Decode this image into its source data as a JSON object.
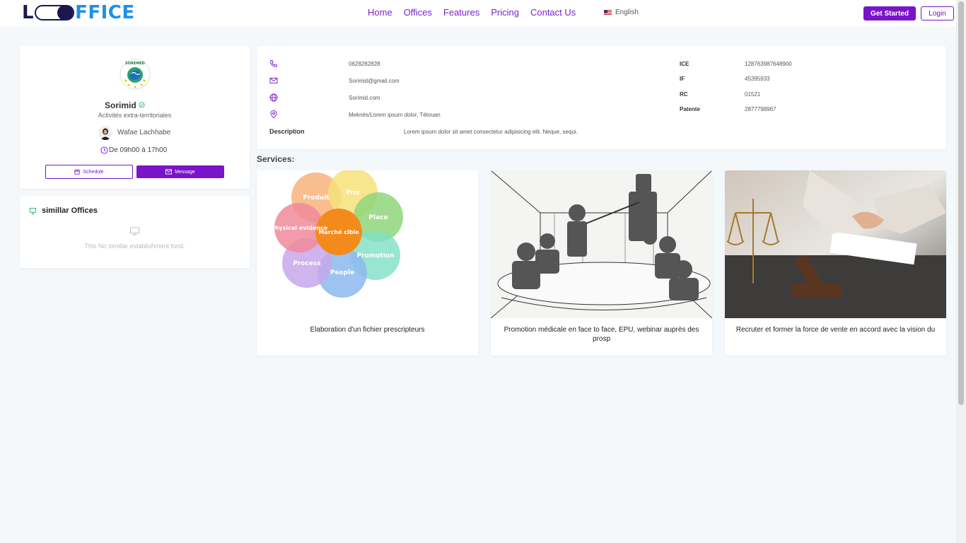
{
  "brand": {
    "logo_left": "L",
    "logo_right": "FFICE"
  },
  "nav": {
    "links": [
      "Home",
      "Offices",
      "Features",
      "Pricing",
      "Contact Us"
    ],
    "language": "English",
    "get_started": "Get Started",
    "login": "Login"
  },
  "profile": {
    "name": "Sorimid",
    "category": "Activités extra-territoriales",
    "owner": "Wafae Lachhabe",
    "hours": "De 09h00 à 17h00",
    "schedule_label": "Schedule",
    "message_label": "Message",
    "emblem_text": "SOREMED"
  },
  "similar": {
    "title": "simillar Offices",
    "empty_text": "This No simillar establishment fund."
  },
  "info": {
    "phone": "0628282828",
    "email": "Sorimid@gmail.com",
    "website": "Sorimid.com",
    "address": "Meknès/Lorem ipsum dolor, Tétouan",
    "ice_label": "ICE",
    "ice_value": "128763987648900",
    "if_label": "IF",
    "if_value": "45395933",
    "rc_label": "RC",
    "rc_value": "01521",
    "patente_label": "Patente",
    "patente_value": "2877798967",
    "description_label": "Description",
    "description_text": "Lorem ipsum dolor sit amet consectetur adipisicing elit. Neque, sequi."
  },
  "services": {
    "title": "Services:",
    "items": [
      {
        "caption": "Elaboration d'un fichier prescripteurs",
        "petals": [
          "Produit",
          "Prix",
          "Place",
          "Promotion",
          "People",
          "Process",
          "Physical evidence"
        ],
        "center": "Marché cible"
      },
      {
        "caption": "Promotion médicale en face to face, EPU, webinar auprès des prosp"
      },
      {
        "caption": "Recruter et former la force de vente en accord avec la vision du"
      }
    ]
  },
  "colors": {
    "accent": "#7a14c8",
    "logo_dark": "#1b1850",
    "logo_blue": "#1e90e8",
    "verified": "#20b66e"
  }
}
